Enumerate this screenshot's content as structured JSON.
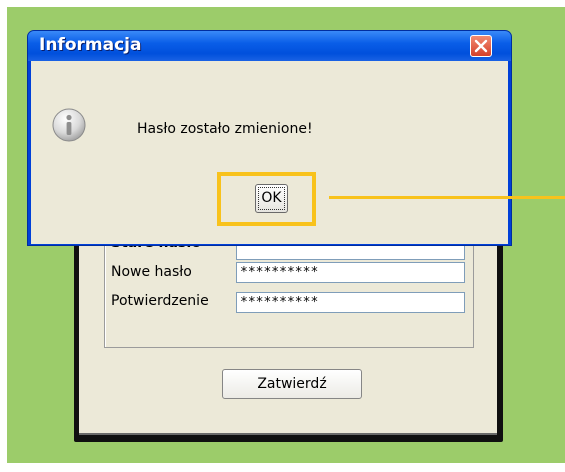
{
  "dialog": {
    "title": "Informacja",
    "message": "Hasło zostało zmienione!",
    "ok_label": "OK",
    "close_icon": "close-icon",
    "info_icon": "information-icon"
  },
  "background_form": {
    "old_password_label": "Stare hasło",
    "new_password_label": "Nowe hasło",
    "new_password_value": "**********",
    "confirm_label": "Potwierdzenie",
    "confirm_value": "**********",
    "submit_label": "Zatwierdź"
  },
  "annotation": {
    "highlight_color": "#f8c21c",
    "target": "ok-button"
  },
  "colors": {
    "page_background": "#9ccc6a",
    "titlebar": "#0a5ee8",
    "dialog_client": "#ece9d8",
    "close_button": "#d5402a"
  }
}
